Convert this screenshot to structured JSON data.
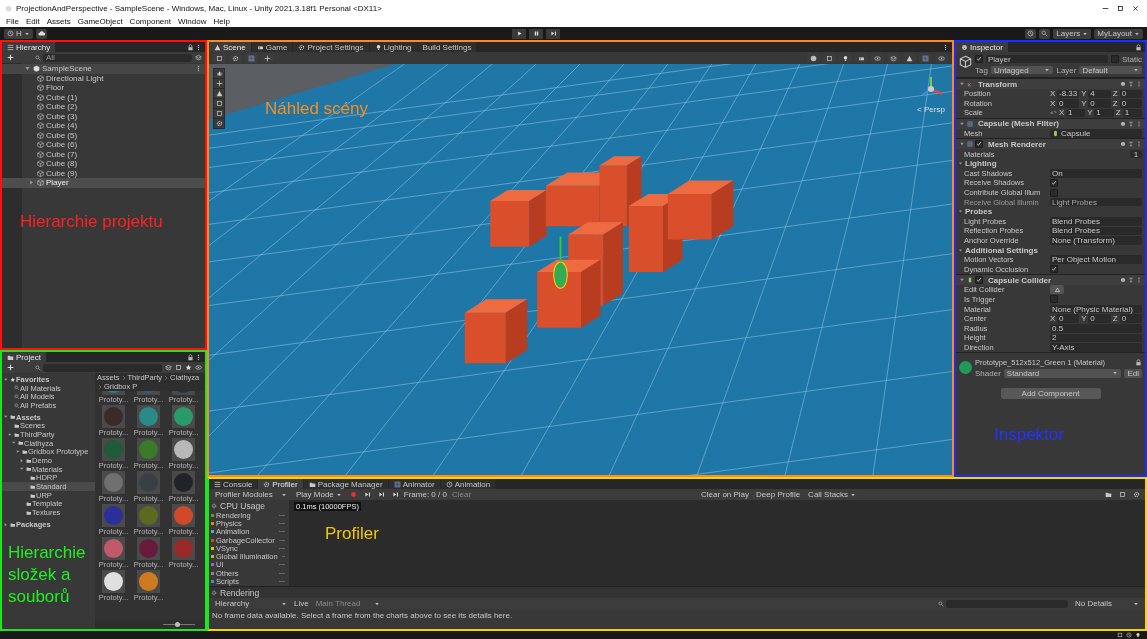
{
  "window": {
    "title": "ProjectionAndPerspective - SampleScene - Windows, Mac, Linux - Unity 2021.3.18f1 Personal <DX11>"
  },
  "menu": [
    "File",
    "Edit",
    "Assets",
    "GameObject",
    "Component",
    "Window",
    "Help"
  ],
  "toolbar": {
    "account": "H",
    "layers": "Layers",
    "layout": "MyLayout"
  },
  "hierarchy": {
    "title": "Hierarchy",
    "search_placeholder": "All",
    "annotation": {
      "text": "Hierarchie projektu",
      "color": "#ff2020"
    },
    "scene": {
      "name": "SampleScene",
      "expanded": true,
      "children": [
        {
          "name": "Directional Light",
          "selected": false
        },
        {
          "name": "Floor",
          "selected": false
        },
        {
          "name": "Cube (1)",
          "selected": false
        },
        {
          "name": "Cube (2)",
          "selected": false
        },
        {
          "name": "Cube (3)",
          "selected": false
        },
        {
          "name": "Cube (4)",
          "selected": false
        },
        {
          "name": "Cube (5)",
          "selected": false
        },
        {
          "name": "Cube (6)",
          "selected": false
        },
        {
          "name": "Cube (7)",
          "selected": false
        },
        {
          "name": "Cube (8)",
          "selected": false
        },
        {
          "name": "Cube (9)",
          "selected": false
        },
        {
          "name": "Player",
          "selected": true,
          "expanded": false
        }
      ]
    }
  },
  "project": {
    "title": "Project",
    "annotation": {
      "text": "Hierarchie složek a souborů",
      "color": "#22ee22"
    },
    "breadcrumb": [
      "Assets",
      "ThirdParty",
      "Ciathyza",
      "Gridbox P"
    ],
    "tree": [
      {
        "name": "Favorites",
        "kind": "favorites",
        "expanded": true,
        "selected": false,
        "children": [
          {
            "name": "All Materials",
            "kind": "search",
            "selected": false
          },
          {
            "name": "All Models",
            "kind": "search",
            "selected": false
          },
          {
            "name": "All Prefabs",
            "kind": "search",
            "selected": false
          }
        ]
      },
      {
        "name": "Assets",
        "kind": "folder",
        "expanded": true,
        "selected": false,
        "children": [
          {
            "name": "Scenes",
            "kind": "folder",
            "selected": false
          },
          {
            "name": "ThirdParty",
            "kind": "folder",
            "expanded": true,
            "selected": false,
            "children": [
              {
                "name": "Ciathyza",
                "kind": "folder",
                "expanded": true,
                "selected": false,
                "children": [
                  {
                    "name": "Gridbox Prototype",
                    "kind": "folder",
                    "expanded": true,
                    "selected": false,
                    "children": [
                      {
                        "name": "Demo",
                        "kind": "folder",
                        "expanded": false,
                        "selected": false
                      },
                      {
                        "name": "Materials",
                        "kind": "folder",
                        "expanded": true,
                        "selected": false,
                        "children": [
                          {
                            "name": "HDRP",
                            "kind": "folder",
                            "selected": false
                          },
                          {
                            "name": "Standard",
                            "kind": "folder",
                            "selected": true
                          },
                          {
                            "name": "URP",
                            "kind": "folder",
                            "selected": false
                          }
                        ]
                      },
                      {
                        "name": "Template",
                        "kind": "folder",
                        "selected": false
                      },
                      {
                        "name": "Textures",
                        "kind": "folder",
                        "selected": false
                      }
                    ]
                  }
                ]
              }
            ]
          }
        ]
      },
      {
        "name": "Packages",
        "kind": "folder",
        "expanded": false,
        "selected": false
      }
    ],
    "assets": [
      {
        "label": "Prototy...",
        "color": "#2f7f8f"
      },
      {
        "label": "Prototy...",
        "color": "#2c5f8a"
      },
      {
        "label": "Prototy...",
        "color": "#2a3440"
      },
      {
        "label": "Prototy...",
        "color": "#3a2a2a"
      },
      {
        "label": "Prototy...",
        "color": "#2a8a8a"
      },
      {
        "label": "Prototy...",
        "color": "#2a9a6a"
      },
      {
        "label": "Prototy...",
        "color": "#1f5a3a"
      },
      {
        "label": "Prototy...",
        "color": "#3a7a2a"
      },
      {
        "label": "Prototy...",
        "color": "#b8b8b8"
      },
      {
        "label": "Prototy...",
        "color": "#707070"
      },
      {
        "label": "Prototy...",
        "color": "#3a3f46"
      },
      {
        "label": "Prototy...",
        "color": "#202428"
      },
      {
        "label": "Prototy...",
        "color": "#2a2f9a"
      },
      {
        "label": "Prototy...",
        "color": "#5a6a1f"
      },
      {
        "label": "Prototy...",
        "color": "#d04a2a"
      },
      {
        "label": "Prototy...",
        "color": "#c05a6a"
      },
      {
        "label": "Prototy...",
        "color": "#6a1a3a"
      },
      {
        "label": "Prototy...",
        "color": "#9a2a2a"
      },
      {
        "label": "Prototy...",
        "color": "#e0e0e0"
      },
      {
        "label": "Prototy...",
        "color": "#d07a20"
      }
    ],
    "zoom": {
      "level": 0.45
    }
  },
  "scene_view": {
    "annotation": {
      "text": "Náhled scény",
      "color": "#ff8c1a"
    },
    "persp": "< Persp",
    "tabs": [
      {
        "label": "Scene",
        "selected": true
      },
      {
        "label": "Game",
        "selected": false
      },
      {
        "label": "Project Settings",
        "selected": false
      },
      {
        "label": "Lighting",
        "selected": false
      },
      {
        "label": "Build Settings",
        "selected": false
      }
    ]
  },
  "inspector": {
    "title": "Inspector",
    "annotation": {
      "text": "Inspektor",
      "color": "#2233ff"
    },
    "object": {
      "name": "Player",
      "active": true,
      "static": false,
      "static_label": "Static",
      "tag_label": "Tag",
      "tag": "Untagged",
      "layer_label": "Layer",
      "layer": "Default"
    },
    "components": [
      {
        "title": "Transform",
        "rows": [
          {
            "kind": "vector",
            "label": "Position",
            "values": [
              {
                "axis": "X",
                "value": "-8.33"
              },
              {
                "axis": "Y",
                "value": "4"
              },
              {
                "axis": "Z",
                "value": "0"
              }
            ]
          },
          {
            "kind": "vector",
            "label": "Rotation",
            "values": [
              {
                "axis": "X",
                "value": "0"
              },
              {
                "axis": "Y",
                "value": "0"
              },
              {
                "axis": "Z",
                "value": "0"
              }
            ]
          },
          {
            "kind": "vector",
            "label": "Scale",
            "linked": true,
            "values": [
              {
                "axis": "X",
                "value": "1"
              },
              {
                "axis": "Y",
                "value": "1"
              },
              {
                "axis": "Z",
                "value": "1"
              }
            ]
          }
        ]
      },
      {
        "title": "Capsule (Mesh Filter)",
        "rows": [
          {
            "kind": "field",
            "label": "Mesh",
            "value": "Capsule",
            "object": true
          }
        ]
      },
      {
        "title": "Mesh Renderer",
        "enabled": true,
        "rows": [
          {
            "kind": "count",
            "label": "Materials",
            "value": "1"
          },
          {
            "kind": "group",
            "label": "Lighting"
          },
          {
            "kind": "field",
            "label": "Cast Shadows",
            "value": "On"
          },
          {
            "kind": "check",
            "label": "Receive Shadows",
            "checked": true
          },
          {
            "kind": "check",
            "label": "Contribute Global Illum",
            "checked": false
          },
          {
            "kind": "field",
            "label": "Receive Global Illumin",
            "value": "Light Probes",
            "disabled": true
          },
          {
            "kind": "group",
            "label": "Probes"
          },
          {
            "kind": "field",
            "label": "Light Probes",
            "value": "Blend Probes"
          },
          {
            "kind": "field",
            "label": "Reflection Probes",
            "value": "Blend Probes"
          },
          {
            "kind": "field",
            "label": "Anchor Override",
            "value": "None (Transform)"
          },
          {
            "kind": "group",
            "label": "Additional Settings"
          },
          {
            "kind": "field",
            "label": "Motion Vectors",
            "value": "Per Object Motion"
          },
          {
            "kind": "check",
            "label": "Dynamic Occlusion",
            "checked": true
          }
        ]
      },
      {
        "title": "Capsule Collider",
        "enabled": true,
        "rows": [
          {
            "kind": "edit",
            "label": "Edit Collider"
          },
          {
            "kind": "check",
            "label": "Is Trigger",
            "checked": false
          },
          {
            "kind": "field",
            "label": "Material",
            "value": "None (Physic Material)"
          },
          {
            "kind": "vector",
            "label": "Center",
            "values": [
              {
                "axis": "X",
                "value": "0"
              },
              {
                "axis": "Y",
                "value": "0"
              },
              {
                "axis": "Z",
                "value": "0"
              }
            ]
          },
          {
            "kind": "field",
            "label": "Radius",
            "value": "0.5"
          },
          {
            "kind": "field",
            "label": "Height",
            "value": "2"
          },
          {
            "kind": "field",
            "label": "Direction",
            "value": "Y-Axis"
          }
        ]
      }
    ],
    "material": {
      "name": "Prototype_512x512_Green 1 (Material)",
      "color": "#1f9a5a",
      "shader_label": "Shader",
      "shader": "Standard",
      "edit": "Edi"
    },
    "add_component": "Add Component"
  },
  "profiler": {
    "annotation": {
      "text": "Profiler",
      "color": "#f0c800"
    },
    "tabs": [
      {
        "label": "Console",
        "selected": false
      },
      {
        "label": "Profiler",
        "selected": true
      },
      {
        "label": "Package Manager",
        "selected": false
      },
      {
        "label": "Animator",
        "selected": false
      },
      {
        "label": "Animation",
        "selected": false
      }
    ],
    "modules_label": "Profiler Modules",
    "mode": "Play Mode",
    "frame": "Frame: 0 / 0",
    "clear": "Clear",
    "clear_on_play": "Clear on Play",
    "deep_profile": "Deep Profile",
    "call_stacks": "Call Stacks",
    "cpu": {
      "title": "CPU Usage",
      "items": [
        {
          "name": "Rendering",
          "color": "#5b9e36"
        },
        {
          "name": "Physics",
          "color": "#d28c14"
        },
        {
          "name": "Animation",
          "color": "#6b9bd2"
        },
        {
          "name": "GarbageCollector",
          "color": "#b35a1f"
        },
        {
          "name": "VSync",
          "color": "#e1c300"
        },
        {
          "name": "Global Illumination",
          "color": "#99c24d"
        },
        {
          "name": "UI",
          "color": "#9966cc"
        },
        {
          "name": "Others",
          "color": "#888888"
        },
        {
          "name": "Scripts",
          "color": "#4f86c6"
        }
      ]
    },
    "chart_label": "0.1ms (10000FPS)",
    "rendering_title": "Rendering",
    "view": "Hierarchy",
    "live": "Live",
    "thread": "Main Thread",
    "details": "No Details",
    "message": "No frame data available. Select a frame from the charts above to see its details here."
  }
}
